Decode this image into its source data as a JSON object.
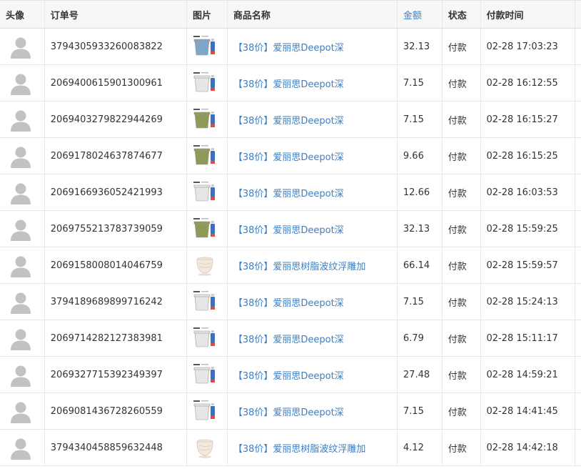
{
  "table": {
    "headers": {
      "avatar": "头像",
      "order_id": "订单号",
      "image": "图片",
      "product_name": "商品名称",
      "amount": "金额",
      "status": "状态",
      "pay_time": "付款时间"
    },
    "rows": [
      {
        "order_id": "3794305933260083822",
        "product": "【38价】爱丽思Deepot深",
        "amount": "32.13",
        "status": "付款",
        "time": "02-28 17:03:23",
        "thumb": "bucket-blue"
      },
      {
        "order_id": "2069400615901300961",
        "product": "【38价】爱丽思Deepot深",
        "amount": "7.15",
        "status": "付款",
        "time": "02-28 16:12:55",
        "thumb": "bucket-white"
      },
      {
        "order_id": "2069403279822944269",
        "product": "【38价】爱丽思Deepot深",
        "amount": "7.15",
        "status": "付款",
        "time": "02-28 16:15:27",
        "thumb": "bucket-olive"
      },
      {
        "order_id": "2069178024637874677",
        "product": "【38价】爱丽思Deepot深",
        "amount": "9.66",
        "status": "付款",
        "time": "02-28 16:15:25",
        "thumb": "bucket-olive"
      },
      {
        "order_id": "2069166936052421993",
        "product": "【38价】爱丽思Deepot深",
        "amount": "12.66",
        "status": "付款",
        "time": "02-28 16:03:53",
        "thumb": "bucket-white"
      },
      {
        "order_id": "2069755213783739059",
        "product": "【38价】爱丽思Deepot深",
        "amount": "32.13",
        "status": "付款",
        "time": "02-28 15:59:25",
        "thumb": "bucket-olive"
      },
      {
        "order_id": "2069158008014046759",
        "product": "【38价】爱丽思树脂波纹浮雕加",
        "amount": "66.14",
        "status": "付款",
        "time": "02-28 15:59:57",
        "thumb": "pot-cream"
      },
      {
        "order_id": "3794189689899716242",
        "product": "【38价】爱丽思Deepot深",
        "amount": "7.15",
        "status": "付款",
        "time": "02-28 15:24:13",
        "thumb": "bucket-white"
      },
      {
        "order_id": "2069714282127383981",
        "product": "【38价】爱丽思Deepot深",
        "amount": "6.79",
        "status": "付款",
        "time": "02-28 15:11:17",
        "thumb": "bucket-white"
      },
      {
        "order_id": "2069327715392349397",
        "product": "【38价】爱丽思Deepot深",
        "amount": "27.48",
        "status": "付款",
        "time": "02-28 14:59:21",
        "thumb": "bucket-white"
      },
      {
        "order_id": "2069081436728260559",
        "product": "【38价】爱丽思Deepot深",
        "amount": "7.15",
        "status": "付款",
        "time": "02-28 14:41:45",
        "thumb": "bucket-white"
      },
      {
        "order_id": "3794340458859632448",
        "product": "【38价】爱丽思树脂波纹浮雕加",
        "amount": "4.12",
        "status": "付款",
        "time": "02-28 14:42:18",
        "thumb": "pot-cream"
      }
    ]
  },
  "colors": {
    "link": "#3d7fc1",
    "bucket-blue": "#7fa6c9",
    "bucket-white": "#e6e6e6",
    "bucket-olive": "#8e9a5a",
    "pot-cream": "#f3e8dc"
  }
}
